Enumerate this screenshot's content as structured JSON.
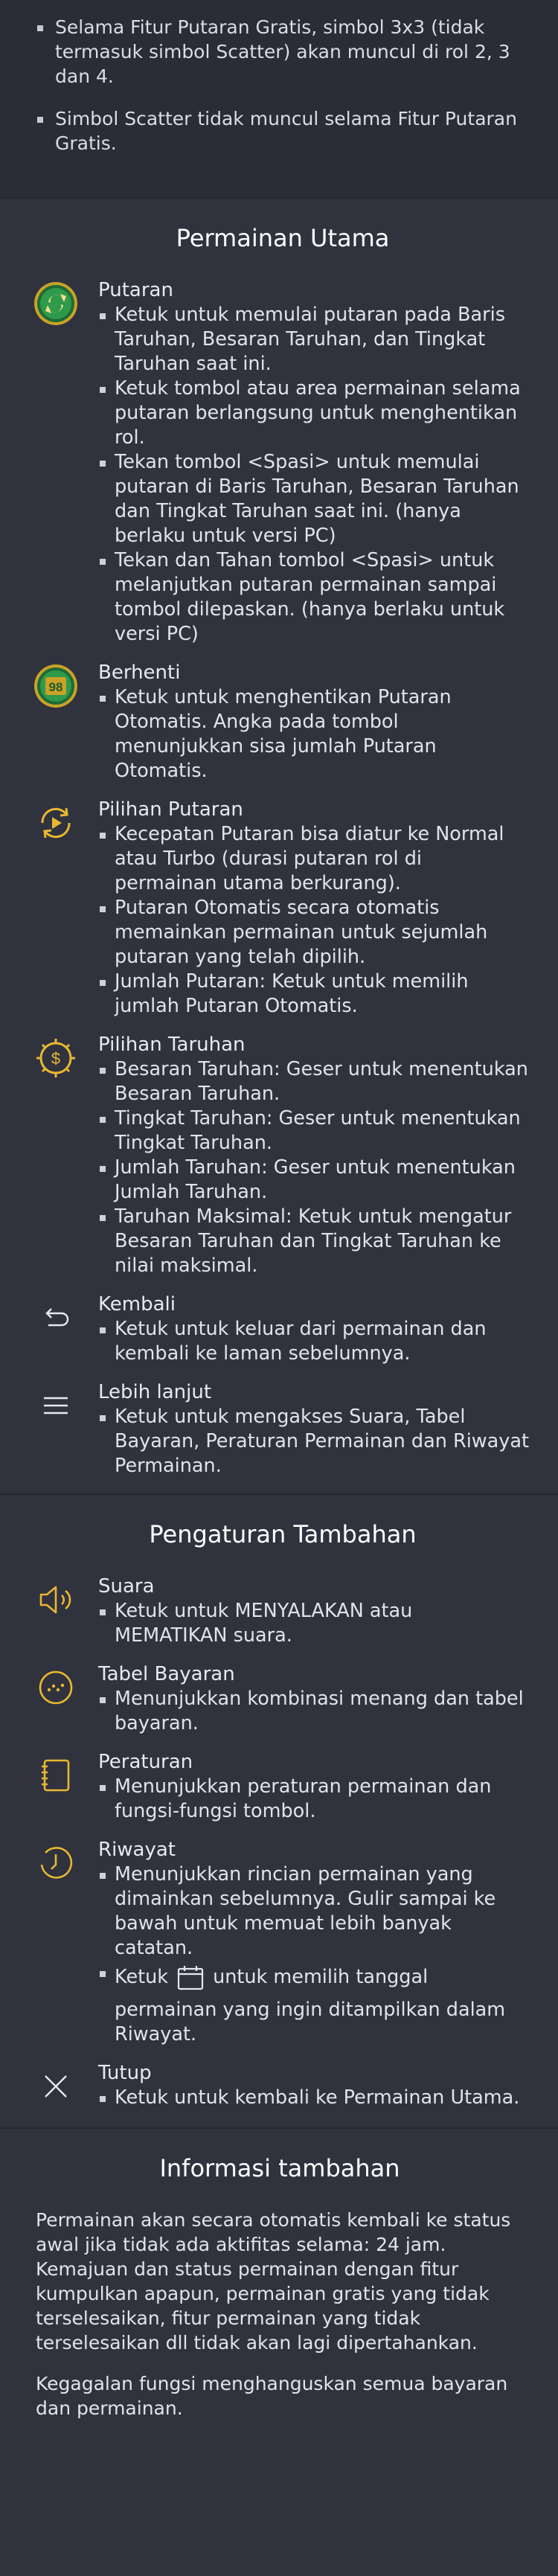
{
  "top_bullets": [
    "Selama Fitur Putaran Gratis, simbol 3x3 (tidak termasuk simbol Scatter) akan muncul di rol 2, 3 dan 4.",
    "Simbol Scatter tidak muncul selama Fitur Putaran Gratis."
  ],
  "main_game": {
    "title": "Permainan Utama",
    "items": [
      {
        "icon": "spin-icon",
        "title": "Putaran",
        "bullets": [
          "Ketuk untuk memulai putaran pada Baris Taruhan, Besaran Taruhan, dan Tingkat Taruhan saat ini.",
          "Ketuk tombol atau area permainan selama putaran berlangsung untuk menghentikan rol.",
          "Tekan tombol <Spasi> untuk memulai putaran di Baris Taruhan, Besaran Taruhan dan Tingkat Taruhan saat ini. (hanya berlaku untuk versi PC)",
          "Tekan dan Tahan tombol <Spasi> untuk melanjutkan putaran permainan sampai tombol dilepaskan. (hanya berlaku untuk versi PC)"
        ]
      },
      {
        "icon": "stop-autospin-icon",
        "icon_text": "98",
        "title": "Berhenti",
        "bullets": [
          "Ketuk untuk menghentikan Putaran Otomatis. Angka pada tombol menunjukkan sisa jumlah Putaran Otomatis."
        ]
      },
      {
        "icon": "spin-options-icon",
        "title": "Pilihan Putaran",
        "bullets": [
          "Kecepatan Putaran bisa diatur ke Normal atau Turbo (durasi putaran rol di permainan utama berkurang).",
          "Putaran Otomatis secara otomatis memainkan permainan untuk sejumlah putaran yang telah dipilih.",
          "Jumlah Putaran: Ketuk untuk memilih jumlah Putaran Otomatis."
        ]
      },
      {
        "icon": "bet-options-icon",
        "title": "Pilihan Taruhan",
        "bullets": [
          "Besaran Taruhan: Geser untuk menentukan Besaran Taruhan.",
          "Tingkat Taruhan: Geser untuk menentukan Tingkat Taruhan.",
          "Jumlah Taruhan: Geser untuk menentukan Jumlah Taruhan.",
          "Taruhan Maksimal: Ketuk untuk mengatur Besaran Taruhan dan Tingkat Taruhan ke nilai maksimal."
        ]
      },
      {
        "icon": "back-icon",
        "title": "Kembali",
        "bullets": [
          "Ketuk untuk keluar dari permainan dan kembali ke laman sebelumnya."
        ]
      },
      {
        "icon": "menu-icon",
        "title": "Lebih lanjut",
        "bullets": [
          "Ketuk untuk mengakses Suara, Tabel Bayaran, Peraturan Permainan dan Riwayat Permainan."
        ]
      }
    ]
  },
  "additional_settings": {
    "title": "Pengaturan Tambahan",
    "items": [
      {
        "icon": "sound-icon",
        "title": "Suara",
        "bullets": [
          "Ketuk untuk MENYALAKAN atau MEMATIKAN suara."
        ]
      },
      {
        "icon": "paytable-icon",
        "title": "Tabel Bayaran",
        "bullets": [
          "Menunjukkan kombinasi menang dan tabel bayaran."
        ]
      },
      {
        "icon": "rules-icon",
        "title": "Peraturan",
        "bullets": [
          "Menunjukkan peraturan permainan dan fungsi-fungsi tombol."
        ]
      },
      {
        "icon": "history-icon",
        "title": "Riwayat",
        "bullets": [
          "Menunjukkan rincian permainan yang dimainkan sebelumnya. Gulir sampai ke bawah untuk memuat lebih banyak catatan."
        ],
        "calendar_bullet": {
          "before": "Ketuk",
          "after": "untuk memilih tanggal",
          "rest": "permainan yang ingin ditampilkan dalam Riwayat."
        }
      },
      {
        "icon": "close-icon",
        "title": "Tutup",
        "bullets": [
          "Ketuk untuk kembali ke Permainan Utama."
        ]
      }
    ]
  },
  "additional_info": {
    "title": "Informasi tambahan",
    "paragraphs": [
      "Permainan akan secara otomatis kembali ke status awal jika tidak ada aktifitas selama: 24 jam. Kemajuan dan status permainan dengan fitur kumpulkan apapun, permainan gratis yang tidak terselesaikan, fitur permainan yang tidak terselesaikan dll tidak akan lagi dipertahankan.",
      "Kegagalan fungsi menghanguskan semua bayaran dan permainan."
    ]
  },
  "colors": {
    "background": "#30323e",
    "accent_gold": "#e8b830",
    "spin_green": "#2f9a4c"
  }
}
